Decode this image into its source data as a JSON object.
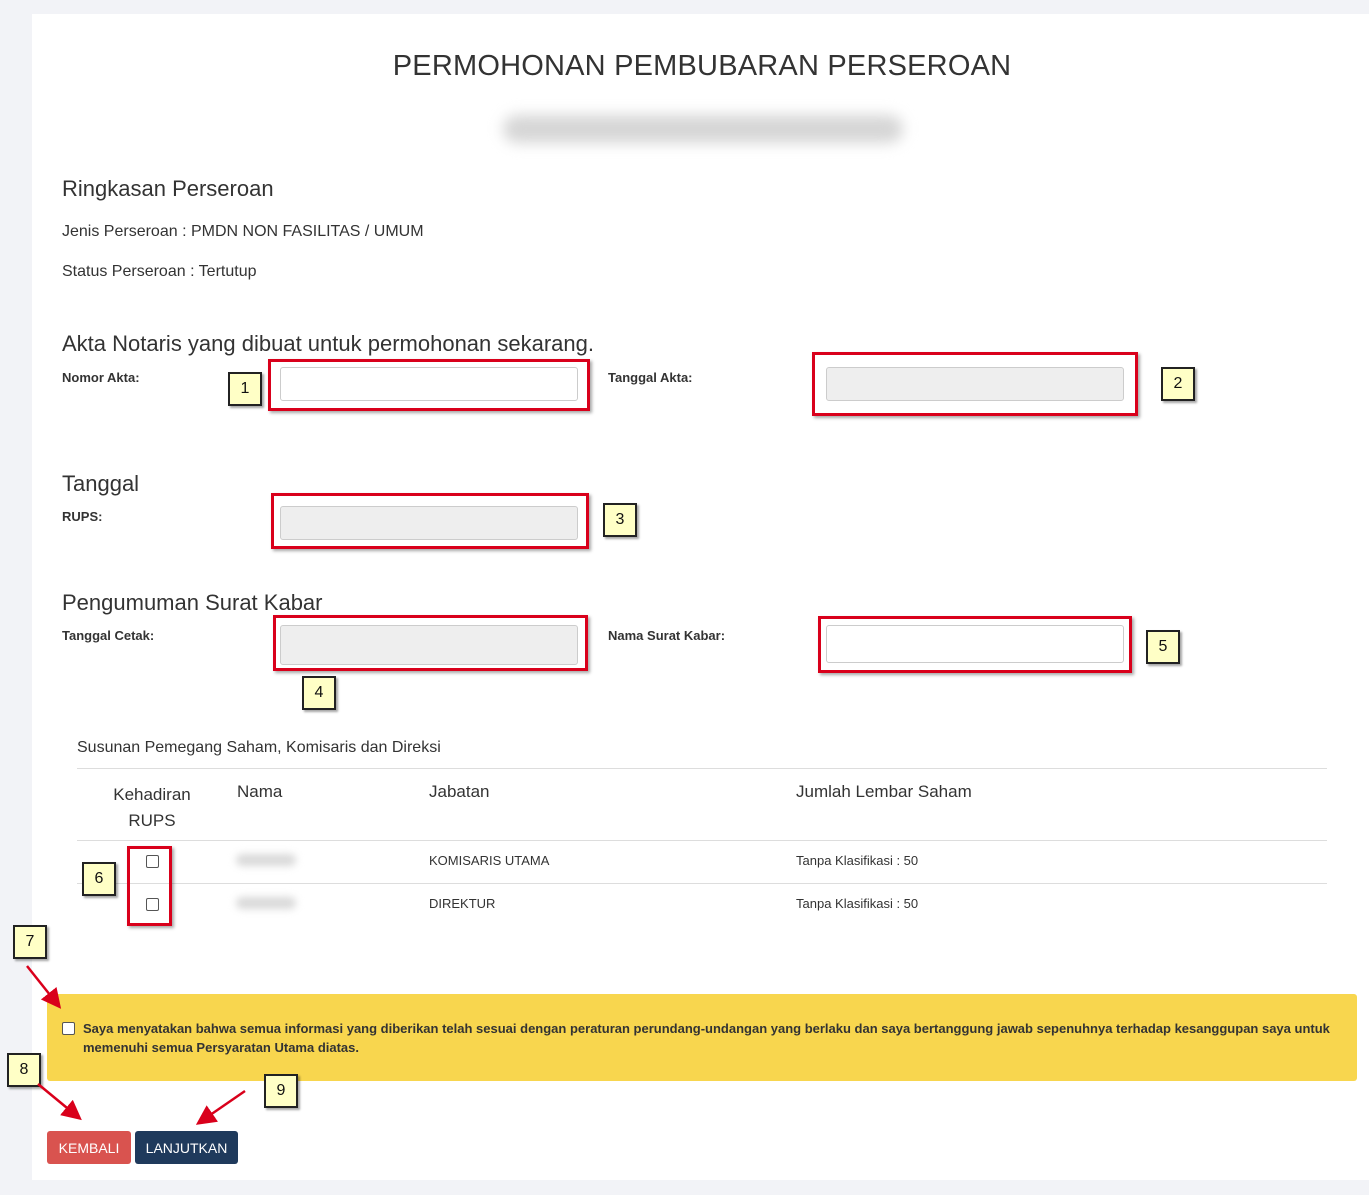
{
  "page": {
    "title": "PERMOHONAN PEMBUBARAN PERSEROAN"
  },
  "summary": {
    "heading": "Ringkasan Perseroan",
    "jenis": "Jenis Perseroan : PMDN NON FASILITAS / UMUM",
    "status": "Status Perseroan : Tertutup"
  },
  "akta": {
    "heading": "Akta Notaris yang dibuat untuk permohonan sekarang.",
    "nomor_label": "Nomor Akta:",
    "nomor_value": "",
    "tanggal_label": "Tanggal Akta:",
    "tanggal_value": ""
  },
  "tanggal": {
    "heading": "Tanggal",
    "rups_label": "RUPS:",
    "rups_value": ""
  },
  "pengumuman": {
    "heading": "Pengumuman Surat Kabar",
    "cetak_label": "Tanggal Cetak:",
    "cetak_value": "",
    "nama_label": "Nama Surat Kabar:",
    "nama_value": ""
  },
  "table": {
    "caption": "Susunan Pemegang Saham, Komisaris dan Direksi",
    "headers": {
      "kehadiran": "Kehadiran RUPS",
      "nama": "Nama",
      "jabatan": "Jabatan",
      "jumlah": "Jumlah Lembar Saham"
    },
    "rows": [
      {
        "jabatan": "KOMISARIS UTAMA",
        "jumlah": "Tanpa Klasifikasi : 50",
        "hadir": false
      },
      {
        "jabatan": "DIREKTUR",
        "jumlah": "Tanpa Klasifikasi : 50",
        "hadir": false
      }
    ]
  },
  "agreement": {
    "text": "Saya menyatakan bahwa semua informasi yang diberikan telah sesuai dengan peraturan perundang-undangan yang berlaku dan saya bertanggung jawab sepenuhnya terhadap kesanggupan saya untuk memenuhi semua Persyaratan Utama diatas.",
    "checked": false
  },
  "buttons": {
    "back": "KEMBALI",
    "next": "LANJUTKAN"
  },
  "callouts": [
    "1",
    "2",
    "3",
    "4",
    "5",
    "6",
    "7",
    "8",
    "9"
  ],
  "colors": {
    "highlight": "#d9001b",
    "callout_bg": "#ffffc6",
    "notice_bg": "#f8d64e",
    "back_button": "#d9534f",
    "next_button": "#1f3a5c"
  },
  "icons": {
    "checkbox": "checkbox-icon",
    "arrow": "red-arrow-icon"
  }
}
